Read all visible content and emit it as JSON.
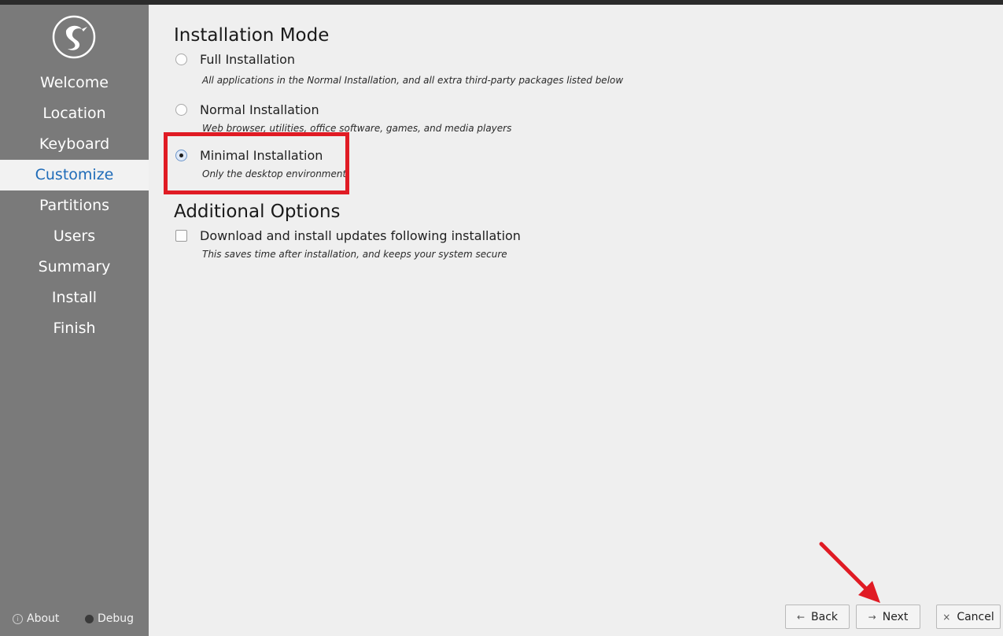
{
  "sidebar": {
    "logo_icon": "hummingbird-logo-icon",
    "steps": [
      {
        "label": "Welcome"
      },
      {
        "label": "Location"
      },
      {
        "label": "Keyboard"
      },
      {
        "label": "Customize",
        "active": true
      },
      {
        "label": "Partitions"
      },
      {
        "label": "Users"
      },
      {
        "label": "Summary"
      },
      {
        "label": "Install"
      },
      {
        "label": "Finish"
      }
    ],
    "about_label": "About",
    "debug_label": "Debug"
  },
  "main": {
    "mode_heading": "Installation Mode",
    "options": [
      {
        "label": "Full Installation",
        "description": "All applications in the Normal Installation, and all extra third-party packages listed below",
        "selected": false
      },
      {
        "label": "Normal Installation",
        "description": "Web browser, utilities, office software, games, and media players",
        "selected": false
      },
      {
        "label": "Minimal Installation",
        "description": "Only the desktop environment",
        "selected": true
      }
    ],
    "additional_heading": "Additional Options",
    "updates": {
      "label": "Download and install updates following installation",
      "description": "This saves time after installation, and keeps your system secure",
      "checked": false
    }
  },
  "buttons": {
    "back_label": "Back",
    "next_label": "Next",
    "cancel_label": "Cancel",
    "back_icon": "arrow-left-icon",
    "next_icon": "arrow-right-icon",
    "cancel_icon": "close-icon"
  },
  "colors": {
    "sidebar_bg": "#7a7a7a",
    "active_step_text": "#1e6bb8",
    "annotation_red": "#e01b24"
  }
}
